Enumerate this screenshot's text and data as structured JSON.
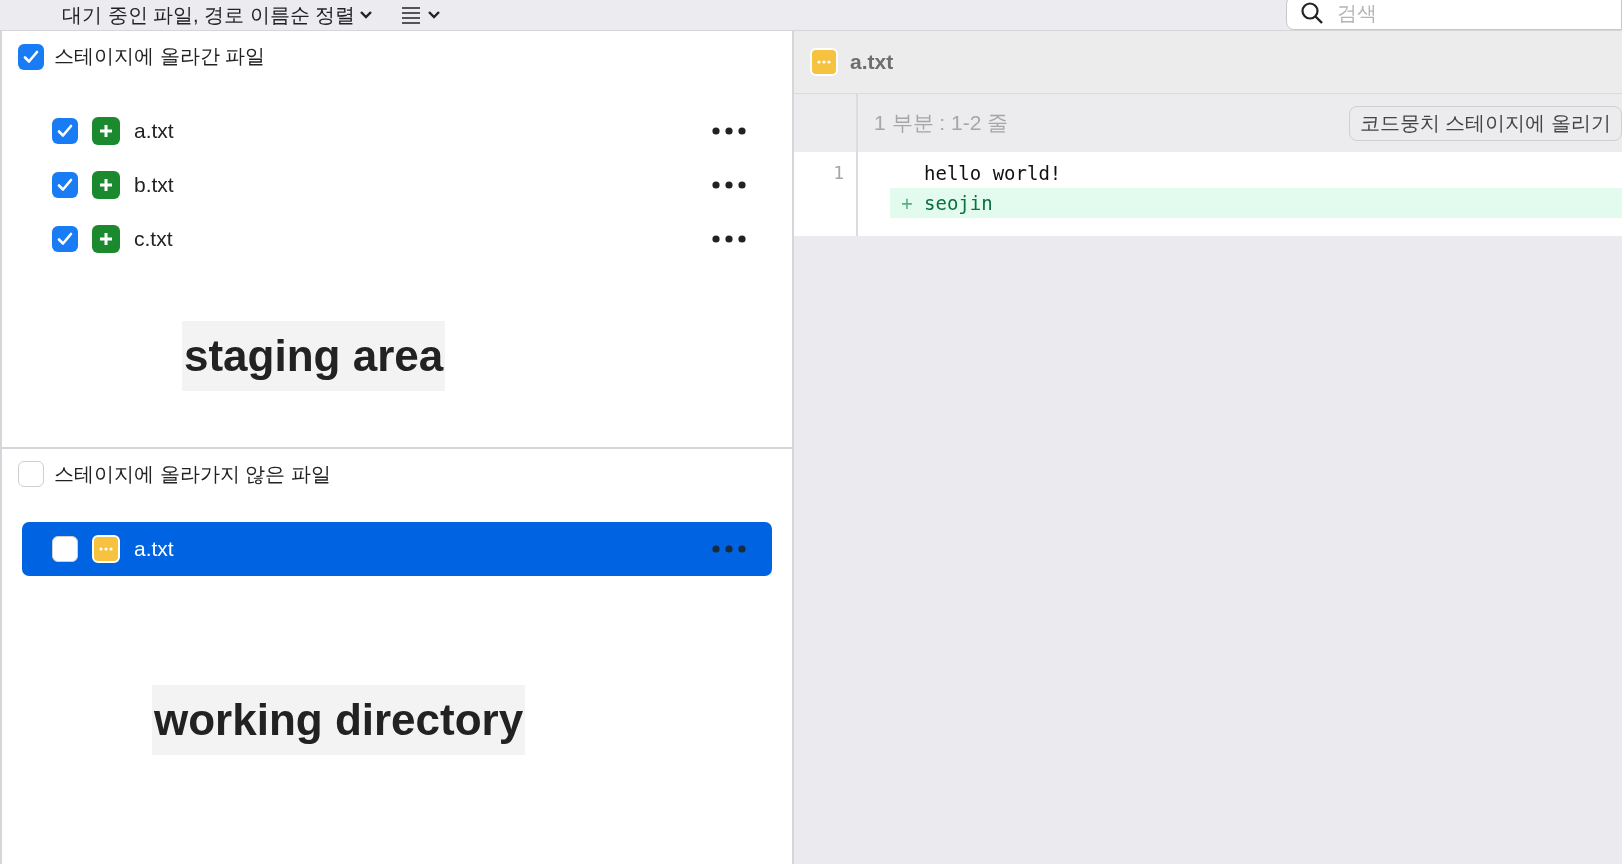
{
  "toolbar": {
    "sort_label": "대기 중인 파일, 경로 이름순 정렬",
    "search": {
      "placeholder": "검색"
    }
  },
  "sections": [
    {
      "title": "스테이지에 올라간 파일",
      "checked": true,
      "files": [
        {
          "name": "a.txt",
          "checked": true,
          "kind": "added",
          "selected": false
        },
        {
          "name": "b.txt",
          "checked": true,
          "kind": "added",
          "selected": false
        },
        {
          "name": "c.txt",
          "checked": true,
          "kind": "added",
          "selected": false
        }
      ],
      "note": "staging area"
    },
    {
      "title": "스테이지에 올라가지 않은 파일",
      "checked": false,
      "files": [
        {
          "name": "a.txt",
          "checked": false,
          "kind": "modified",
          "selected": true
        }
      ],
      "note": "working directory"
    }
  ],
  "diff": {
    "file": {
      "name": "a.txt",
      "kind": "modified"
    },
    "hunk_header": "1 부분 : 1-2 줄",
    "stage_button": "코드뭉치 스테이지에 올리기",
    "lines": [
      {
        "number": "1",
        "kind": "context",
        "text": "hello world!"
      },
      {
        "kind": "added",
        "marker": "+",
        "text": "seojin"
      }
    ]
  }
}
